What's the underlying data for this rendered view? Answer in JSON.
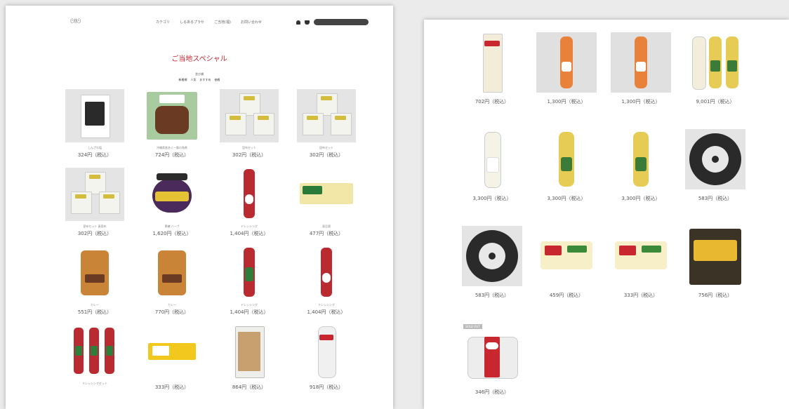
{
  "header": {
    "logo_text": "ᘛᘚ",
    "nav": [
      "カテゴリ",
      "しるあるプラセ",
      "ご当地(福)",
      "お問い合わせ"
    ]
  },
  "page_title": "ご当地スペシャル",
  "sort": {
    "label": "並び順",
    "options": [
      "新着順",
      "人気",
      "おすすめ",
      "価格"
    ]
  },
  "products_left": [
    {
      "name": "しんざわ塩",
      "price": "324円（税込）",
      "icon": "white-salt-bag"
    },
    {
      "name": "沖縄県産あぐー豚の角煮",
      "price": "724円（税込）",
      "icon": "pork-pack"
    },
    {
      "name": "昆布セット",
      "price": "302円（税込）",
      "icon": "packets-set"
    },
    {
      "name": "昆布セット",
      "price": "302円（税込）",
      "icon": "packets-set"
    },
    {
      "name": "昆布セット 真昆布",
      "price": "302円（税込）",
      "icon": "packets-set"
    },
    {
      "name": "黒糖 ハーブ",
      "price": "1,620円（税込）",
      "icon": "jar"
    },
    {
      "name": "ドレッシング",
      "price": "1,404円（税込）",
      "icon": "red-bottle"
    },
    {
      "name": "島豆腐",
      "price": "477円（税込）",
      "icon": "tofu-pack"
    },
    {
      "name": "カレー",
      "price": "551円（税込）",
      "icon": "pouch"
    },
    {
      "name": "カレー",
      "price": "770円（税込）",
      "icon": "pouch"
    },
    {
      "name": "ドレッシング",
      "price": "1,404円（税込）",
      "icon": "green-bottle"
    },
    {
      "name": "ドレッシング",
      "price": "1,404円（税込）",
      "icon": "red-bottle"
    },
    {
      "name": "ドレッシングセット",
      "price": "",
      "icon": "three-bottles"
    },
    {
      "name": "",
      "price": "333円（税込）",
      "icon": "yellow-snack"
    },
    {
      "name": "",
      "price": "864円（税込）",
      "icon": "noodle-box"
    },
    {
      "name": "",
      "price": "918円（税込）",
      "icon": "noodle-tube"
    }
  ],
  "products_right": [
    {
      "name": "",
      "price": "702円（税込）",
      "icon": "noodle-pack"
    },
    {
      "name": "",
      "price": "1,300円（税込）",
      "icon": "orange-bottle"
    },
    {
      "name": "",
      "price": "1,300円（税込）",
      "icon": "orange-bottle"
    },
    {
      "name": "",
      "price": "9,001円（税込）",
      "icon": "three-bottles-yellow"
    },
    {
      "name": "",
      "price": "3,300円（税込）",
      "icon": "clear-bottle"
    },
    {
      "name": "",
      "price": "3,300円（税込）",
      "icon": "yellow-bottle"
    },
    {
      "name": "",
      "price": "3,300円（税込）",
      "icon": "yellow-bottle"
    },
    {
      "name": "",
      "price": "583円（税込）",
      "icon": "lotus-dark"
    },
    {
      "name": "",
      "price": "583円（税込）",
      "icon": "lotus-dark"
    },
    {
      "name": "",
      "price": "459円（税込）",
      "icon": "snack-pack"
    },
    {
      "name": "",
      "price": "333円（税込）",
      "icon": "snack-pack"
    },
    {
      "name": "",
      "price": "756円（税込）",
      "icon": "dark-bag"
    },
    {
      "name": "",
      "price": "346円（税込）",
      "icon": "red-cup",
      "badge": "SOLD OUT"
    }
  ]
}
